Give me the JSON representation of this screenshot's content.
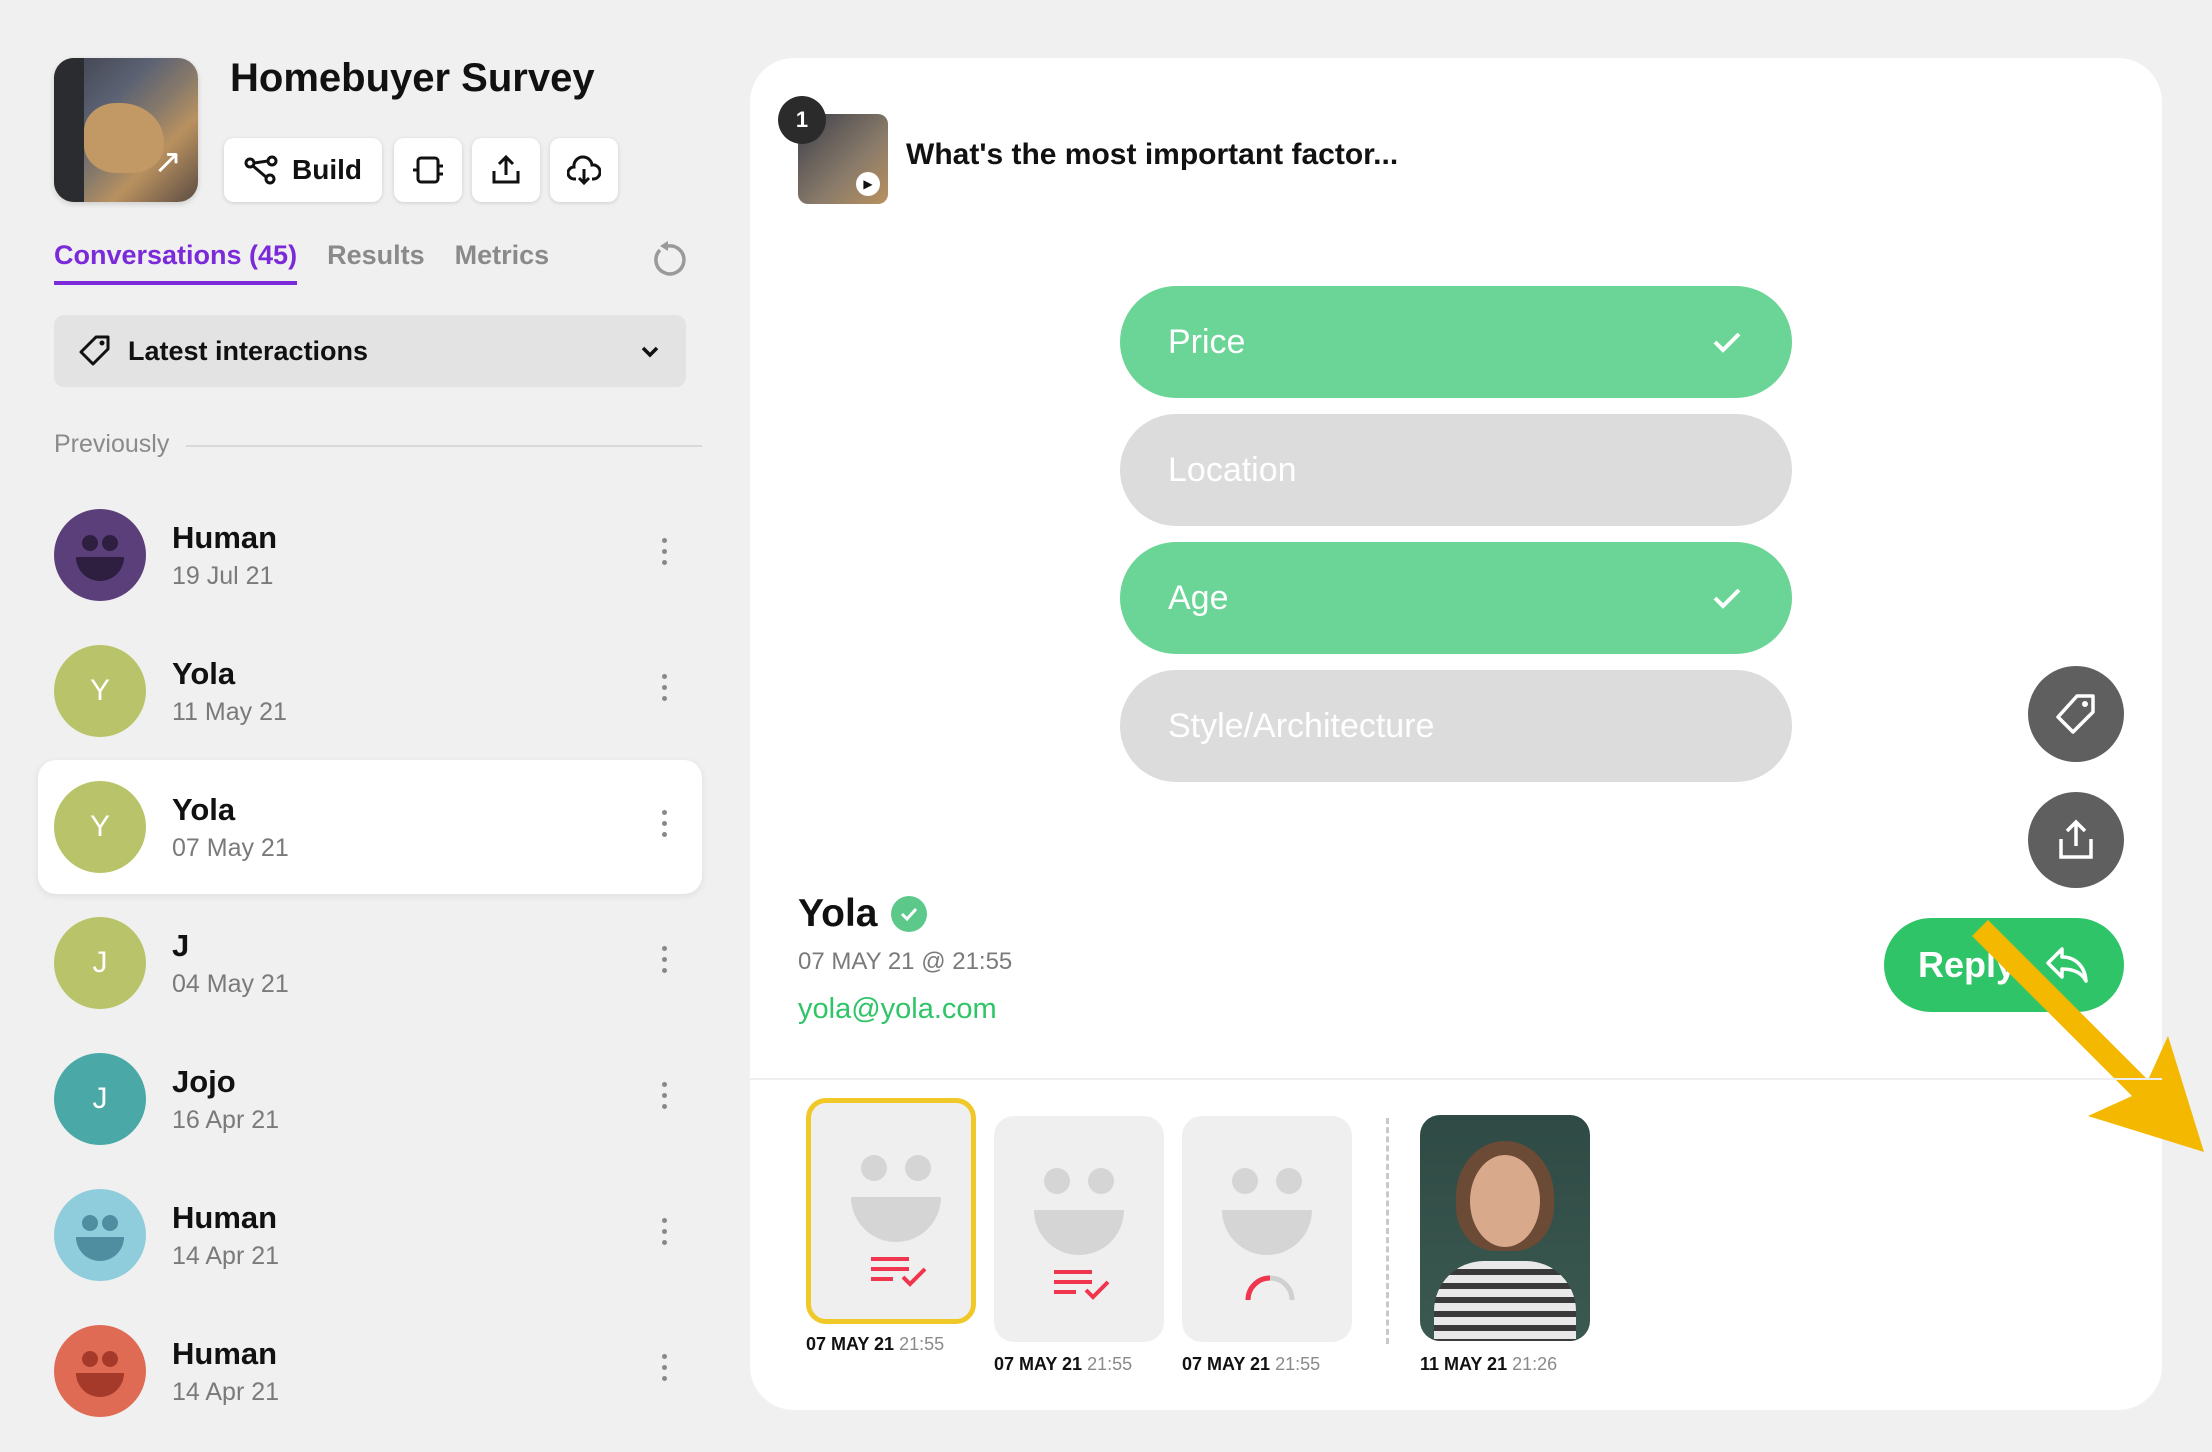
{
  "survey": {
    "title": "Homebuyer Survey",
    "toolbar": {
      "build_label": "Build"
    }
  },
  "tabs": [
    {
      "label": "Conversations (45)",
      "active": true
    },
    {
      "label": "Results"
    },
    {
      "label": "Metrics"
    }
  ],
  "filter": {
    "label": "Latest interactions"
  },
  "section_label": "Previously",
  "conversations": [
    {
      "name": "Human",
      "date": "19 Jul 21",
      "avatar": "face",
      "color": "#5b3f7a"
    },
    {
      "name": "Yola",
      "date": "11 May 21",
      "avatar": "Y",
      "color": "#b9c46a"
    },
    {
      "name": "Yola",
      "date": "07 May 21",
      "avatar": "Y",
      "color": "#b9c46a",
      "active": true
    },
    {
      "name": "J",
      "date": "04 May 21",
      "avatar": "J",
      "color": "#b9c46a"
    },
    {
      "name": "Jojo",
      "date": "16 Apr 21",
      "avatar": "J",
      "color": "#4aa9a6"
    },
    {
      "name": "Human",
      "date": "14 Apr 21",
      "avatar": "face",
      "color": "#8fcddd"
    },
    {
      "name": "Human",
      "date": "14 Apr 21",
      "avatar": "face",
      "color": "#e06b55"
    }
  ],
  "question": {
    "number": "1",
    "text": "What's the most important factor...",
    "options": [
      {
        "label": "Price",
        "selected": true
      },
      {
        "label": "Location",
        "selected": false
      },
      {
        "label": "Age",
        "selected": true
      },
      {
        "label": "Style/Architecture",
        "selected": false
      }
    ]
  },
  "respondent": {
    "name": "Yola",
    "datetime": "07 MAY 21 @ 21:55",
    "email": "yola@yola.com"
  },
  "reply_label": "Reply",
  "tiles": [
    {
      "date": "07 MAY 21",
      "time": "21:55",
      "icon": "text-check-icon",
      "selected": true
    },
    {
      "date": "07 MAY 21",
      "time": "21:55",
      "icon": "text-check-icon"
    },
    {
      "date": "07 MAY 21",
      "time": "21:55",
      "icon": "progress-arc-icon"
    },
    {
      "date": "11 MAY 21",
      "time": "21:26",
      "icon": "video-thumbnail"
    }
  ],
  "colors": {
    "accent_purple": "#7a2ad8",
    "selected_green": "#6ad596",
    "reply_green": "#2fc467",
    "highlight_yellow": "#f0c929",
    "arrow_orange": "#f5b800"
  }
}
